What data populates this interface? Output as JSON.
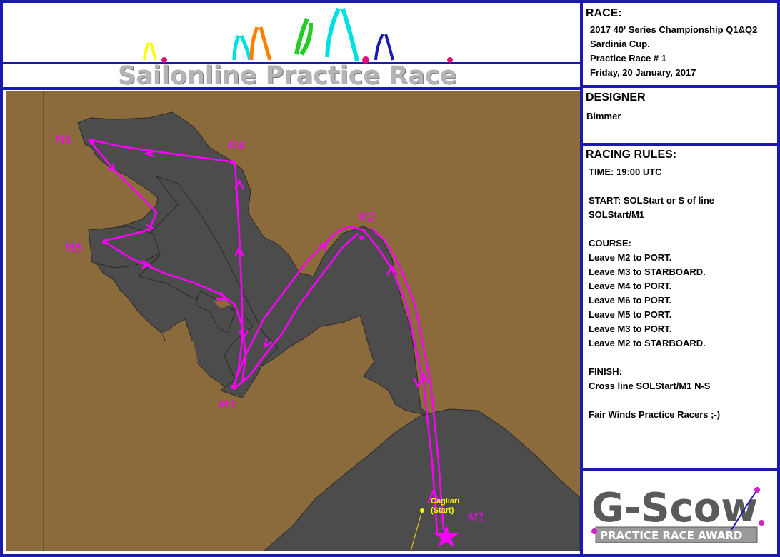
{
  "banner": {
    "title": "Sailonline Practice Race"
  },
  "race_panel": {
    "heading": "RACE:",
    "lines": [
      "2017 40' Series Championship Q1&Q2",
      "Sardinia Cup.",
      "Practice Race # 1",
      "Friday, 20 January, 2017"
    ]
  },
  "designer_panel": {
    "heading": "DESIGNER",
    "name": "Bimmer"
  },
  "rules_panel": {
    "heading": "RACING RULES:",
    "time": "TIME: 19:00 UTC",
    "start_1": "START: SOLStart or S of line",
    "start_2": "SOLStart/M1",
    "course_heading": "COURSE:",
    "course": [
      "Leave M2 to PORT.",
      "Leave M3 to STARBOARD.",
      "Leave M4 to PORT.",
      "Leave M6 to PORT.",
      "Leave M5 to PORT.",
      "Leave M3 to PORT.",
      "Leave M2 to STARBOARD."
    ],
    "finish_heading": "FINISH:",
    "finish": "Cross line SOLStart/M1 N-S",
    "closing": "Fair Winds Practice Racers  ;-)"
  },
  "map": {
    "marks": [
      "M1",
      "M2",
      "M3",
      "M4",
      "M5",
      "M6"
    ],
    "city_label_1": "Cagliari",
    "city_label_2": "(Start)",
    "colors": {
      "sea": "#8b6a3c",
      "land": "#4c4c4c",
      "course": "#ff00ff",
      "city": "#ffff00"
    }
  },
  "award": {
    "title": "G-Scow",
    "subtitle": "PRACTICE RACE AWARD"
  },
  "colors": {
    "frame": "#1a1ab0"
  }
}
